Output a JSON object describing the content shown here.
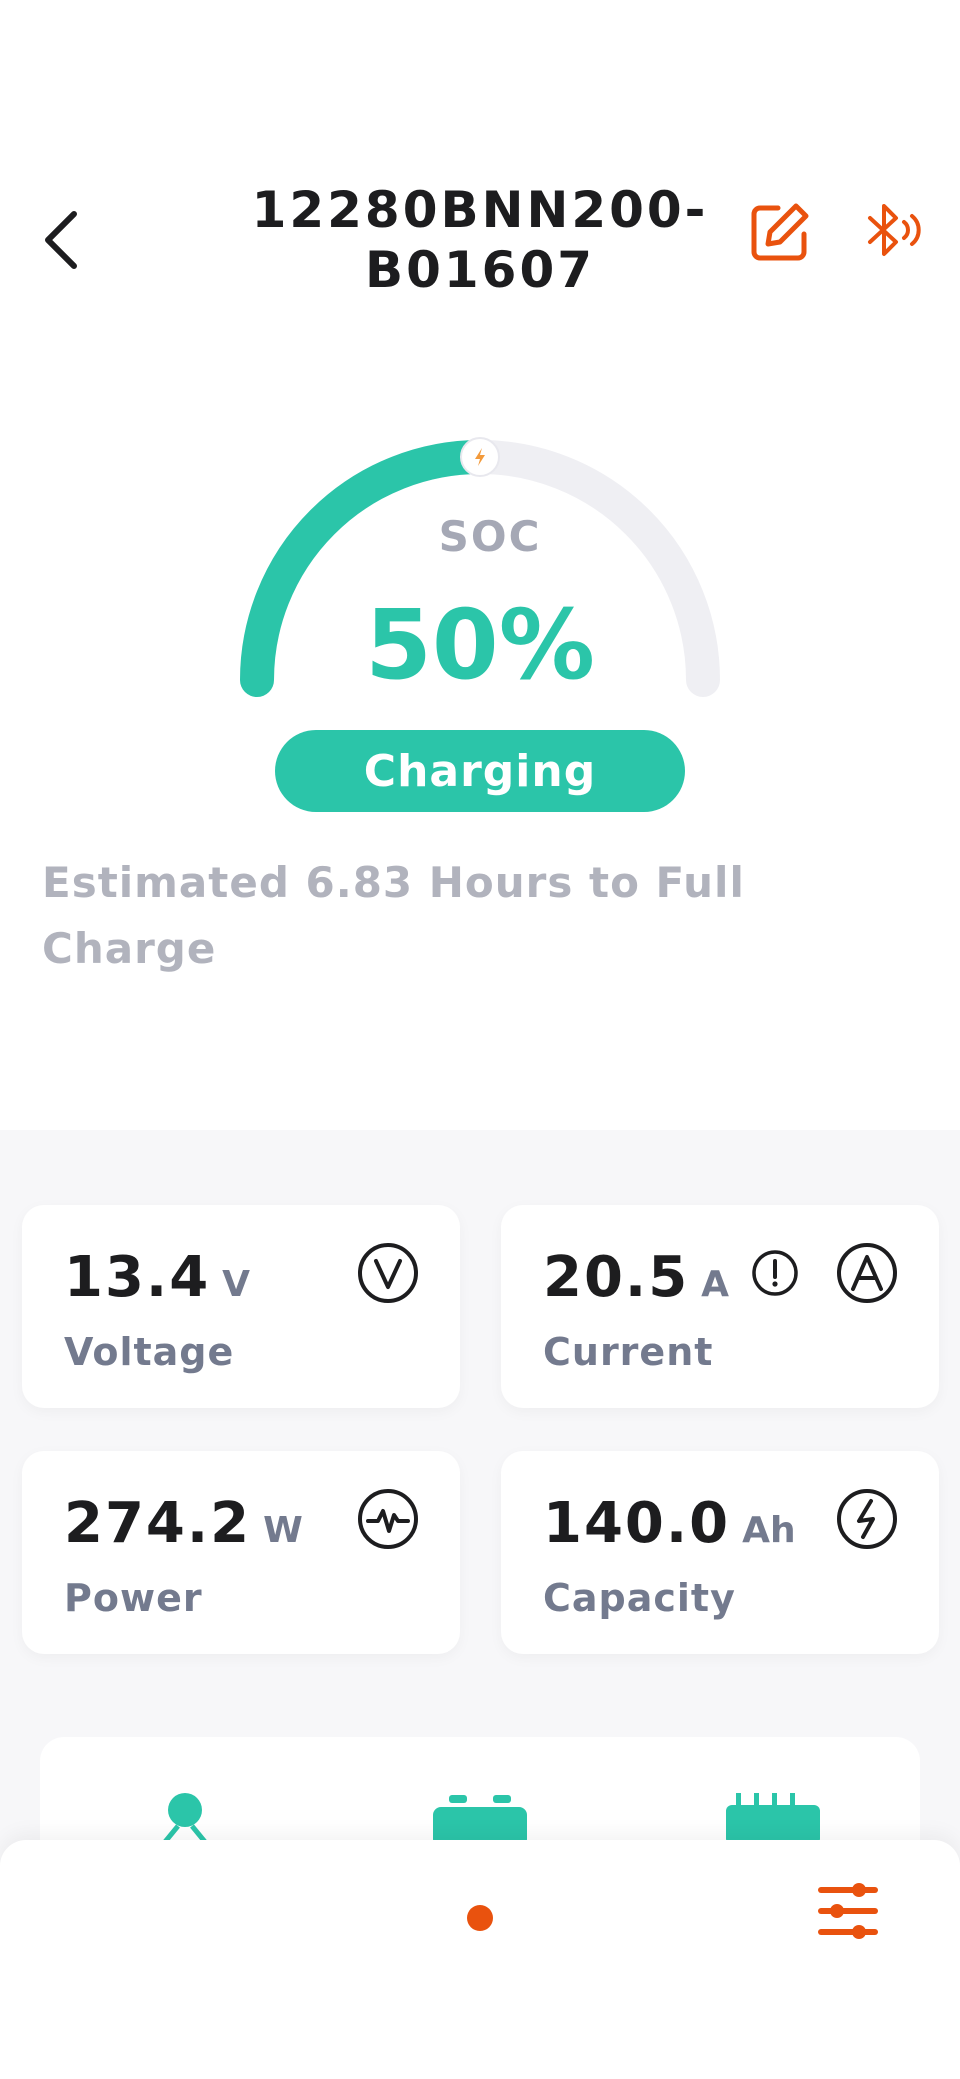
{
  "header": {
    "title": "12280BNN200-B01607",
    "back_icon": "chevron-left-icon",
    "edit_icon": "edit-icon",
    "bluetooth_icon": "bluetooth-icon"
  },
  "soc": {
    "label": "SOC",
    "value": "50%",
    "fraction": 0.5,
    "status": "Charging",
    "estimate": "Estimated 6.83 Hours to Full Charge"
  },
  "metrics": [
    {
      "value": "13.4",
      "unit": "V",
      "label": "Voltage",
      "icon": "voltage-icon"
    },
    {
      "value": "20.5",
      "unit": "A",
      "label": "Current",
      "icon": "ampere-icon",
      "alert_icon": "alert-icon"
    },
    {
      "value": "274.2",
      "unit": "W",
      "label": "Power",
      "icon": "power-pulse-icon"
    },
    {
      "value": "140.0",
      "unit": "Ah",
      "label": "Capacity",
      "icon": "lightning-icon"
    }
  ],
  "bottom_icons": [
    "user-icon",
    "battery-icon",
    "bms-icon"
  ],
  "tabbar": {
    "icons": [
      "active-dot-icon",
      "settings-sliders-icon"
    ]
  },
  "colors": {
    "accent": "#2bc5a9",
    "brand_orange": "#e9520e",
    "text_dark": "#1d1d1f",
    "text_muted": "#737a8e",
    "text_light": "#b1b3bd"
  }
}
